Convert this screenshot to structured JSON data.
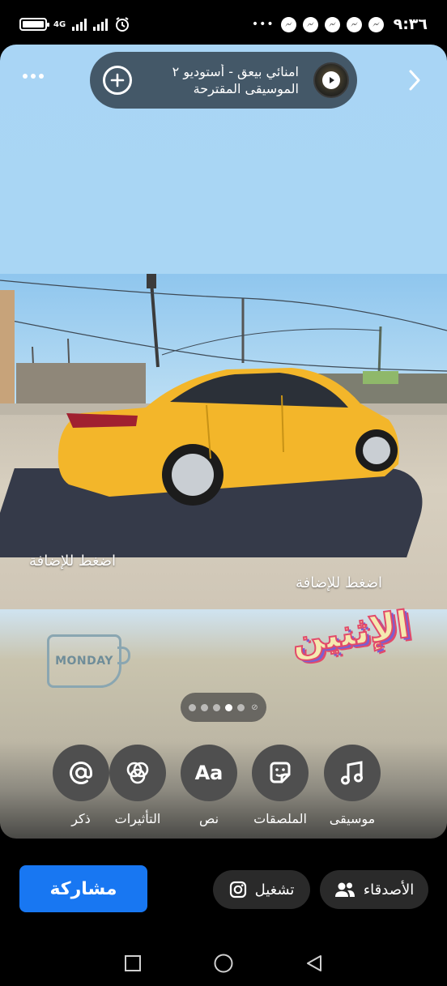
{
  "status_bar": {
    "time": "٩:٣٦",
    "network": "4G",
    "network_sub": "4G"
  },
  "story": {
    "music": {
      "title": "امنائي بيعق - أستوديو ٢",
      "subtitle": "الموسيقى المقترحة"
    },
    "tap_to_add_left": "اضغط للإضافة",
    "tap_to_add_right": "اضغط للإضافة",
    "monday_sticker": "MONDAY",
    "athan_sticker": "الإثنين",
    "pager": {
      "total": 5,
      "active_index": 3
    },
    "tools": [
      {
        "label": "موسيقى",
        "icon": "music-note-icon"
      },
      {
        "label": "الملصقات",
        "icon": "sticker-icon"
      },
      {
        "label": "نص",
        "icon": "text-aa-icon"
      },
      {
        "label": "التأثيرات",
        "icon": "effects-icon"
      },
      {
        "label": "ذكر",
        "icon": "mention-at-icon"
      }
    ]
  },
  "bottom": {
    "share_label": "مشاركة",
    "play_label": "تشغيل",
    "friends_label": "الأصدقاء"
  },
  "colors": {
    "accent": "#1877f2",
    "chip_bg": "#2a2a2a",
    "tool_circle": "#4f4f4f",
    "car_yellow": "#f3b62a"
  }
}
